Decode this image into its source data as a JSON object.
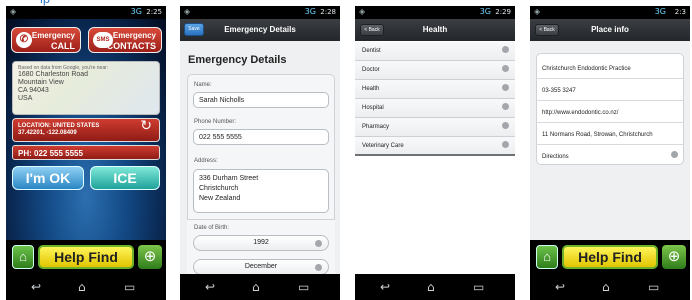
{
  "header_fragment": "lp",
  "status": {
    "phone1_time": "2:25",
    "phone2_time": "2:28",
    "phone3_time": "2:29",
    "phone4_time": "2:3",
    "signal": "3G"
  },
  "phone1": {
    "emergency_call_line1": "Emergency",
    "emergency_call_line2": "CALL",
    "emergency_contacts_line1": "Emergency",
    "emergency_contacts_line2": "CONTACTS",
    "sms_badge": "SMS",
    "address_note": "Based on data from Google, you're near:",
    "address_lines": [
      "1680 Charleston Road",
      "Mountain View",
      "CA 94043",
      "USA"
    ],
    "location_line1": "LOCATION: UNITED STATES",
    "location_line2": "37.42201, -122.08409",
    "phone_line": "PH: 022 555 5555",
    "ok_label": "I'm OK",
    "ice_label": "ICE",
    "help_find_label": "Help Find"
  },
  "phone2": {
    "save_label": "Save",
    "title": "Emergency Details",
    "heading": "Emergency Details",
    "name_label": "Name:",
    "name_value": "Sarah Nicholls",
    "phone_label": "Phone Number:",
    "phone_value": "022 555 5555",
    "address_label": "Address:",
    "address_lines": [
      "336 Durham Street",
      "Christchurch",
      "New Zealand"
    ],
    "dob_label": "Date of Birth:",
    "dob_year": "1992",
    "dob_month": "December"
  },
  "phone3": {
    "back_label": "< Back",
    "title": "Health",
    "items": [
      "Dentist",
      "Doctor",
      "Health",
      "Hospital",
      "Pharmacy",
      "Veterinary Care"
    ]
  },
  "phone4": {
    "back_label": "< Back",
    "title": "Place info",
    "place_name": "Christchurch Endodontic Practice",
    "place_phone": "03-355 3247",
    "place_url": "http://www.endodontic.co.nz/",
    "place_address": "11 Normans Road, Strowan, Christchurch",
    "directions_label": "Directions",
    "help_find_label": "Help Find"
  },
  "icons": {
    "back": "↩",
    "home": "⌂",
    "recent": "▭",
    "home_button": "⌂",
    "globe": "⊕",
    "refresh": "↻",
    "phone": "✆"
  }
}
